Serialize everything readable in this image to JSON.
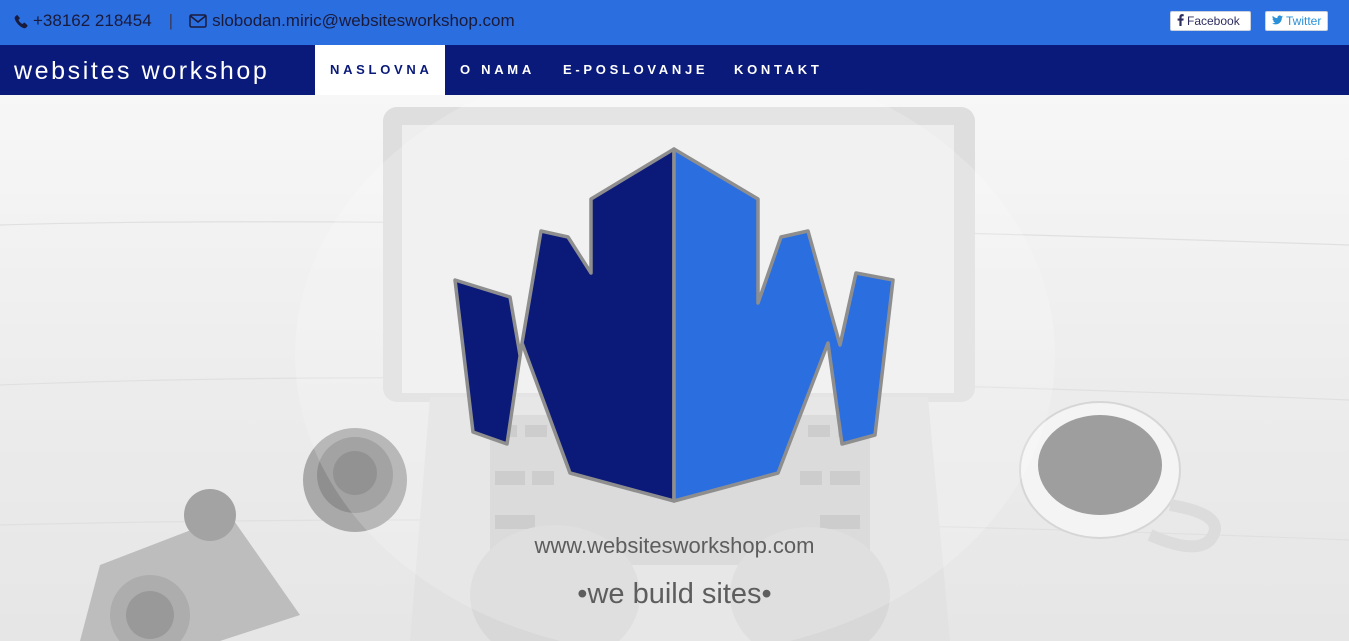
{
  "topbar": {
    "phone": "+38162 218454",
    "separator": "|",
    "email": "slobodan.miric@websitesworkshop.com",
    "facebook_label": "Facebook",
    "twitter_label": "Twitter"
  },
  "nav": {
    "brand": "websites workshop",
    "items": [
      {
        "label": "NASLOVNA",
        "active": true
      },
      {
        "label": "O NAMA",
        "active": false
      },
      {
        "label": "E-POSLOVANJE",
        "active": false
      },
      {
        "label": "KONTAKT",
        "active": false
      }
    ]
  },
  "hero": {
    "url_text": "www.websitesworkshop.com",
    "tagline": "•we build sites•"
  },
  "colors": {
    "topbar": "#2a6ee0",
    "navbar": "#0a1a7a",
    "logo_dark": "#0b1a78",
    "logo_light": "#2a6ee0",
    "logo_outline": "#8e8e8e"
  },
  "icons": [
    "phone-icon",
    "envelope-icon",
    "facebook-icon",
    "twitter-icon"
  ]
}
